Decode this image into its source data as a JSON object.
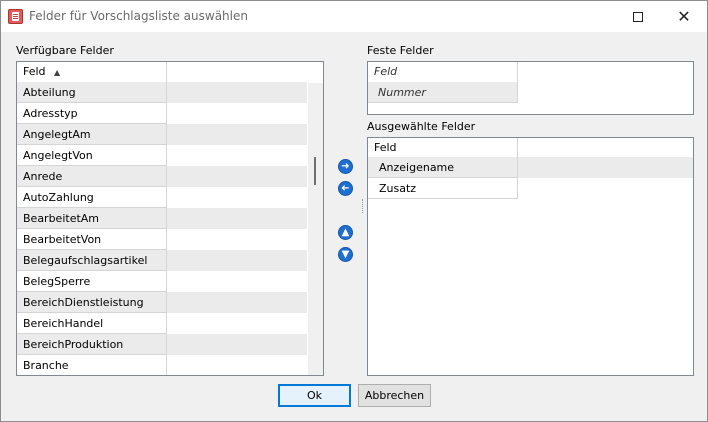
{
  "window": {
    "title": "Felder für Vorschlagsliste auswählen",
    "maximize_icon": "maximize-icon",
    "close_icon": "close-icon"
  },
  "available": {
    "label": "Verfügbare Felder",
    "header": "Feld",
    "sort_icon": "sort-ascending-icon",
    "items": [
      "Abteilung",
      "Adresstyp",
      "AngelegtAm",
      "AngelegtVon",
      "Anrede",
      "AutoZahlung",
      "BearbeitetAm",
      "BearbeitetVon",
      "Belegaufschlagsartikel",
      "BelegSperre",
      "BereichDienstleistung",
      "BereichHandel",
      "BereichProduktion",
      "Branche"
    ]
  },
  "fixed": {
    "label": "Feste Felder",
    "header": "Feld",
    "items": [
      "Nummer"
    ]
  },
  "selected": {
    "label": "Ausgewählte Felder",
    "header": "Feld",
    "items": [
      "Anzeigename",
      "Zusatz"
    ]
  },
  "actions": {
    "add_icon": "arrow-right-icon",
    "remove_icon": "arrow-left-icon",
    "up_icon": "arrow-up-icon",
    "down_icon": "arrow-down-icon"
  },
  "buttons": {
    "ok": "Ok",
    "cancel": "Abbrechen"
  },
  "colors": {
    "accent": "#1f6fd1",
    "row_alt": "#ebebeb"
  }
}
